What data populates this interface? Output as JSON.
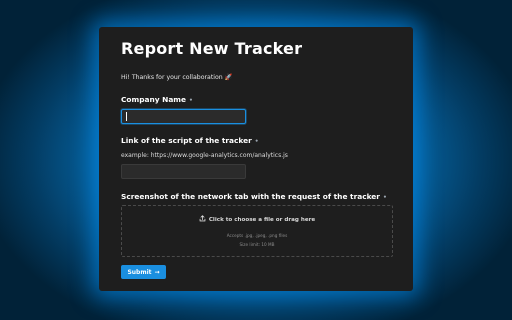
{
  "form": {
    "title": "Report New Tracker",
    "intro": "Hi! Thanks for your collaboration 🚀",
    "required_marker": "•",
    "company_label": "Company Name",
    "company_value": "",
    "link_label": "Link of the script of the tracker",
    "link_example": "example: https://www.google-analytics.com/analytics.js",
    "link_value": "",
    "screenshot_label": "Screenshot of the network tab with the request of the tracker",
    "dropzone": {
      "main_text": "Click to choose a file or drag here",
      "accepts": "Accepts .jpg, .jpeg, .png files",
      "size_limit": "Size limit: 10 MB"
    },
    "submit_label": "Submit",
    "submit_arrow": "→"
  },
  "colors": {
    "accent": "#1a8fe0",
    "card_bg": "#1e1e1e",
    "glow": "#0a86d6"
  },
  "icons": {
    "upload": "upload-icon",
    "arrow": "arrow-right-icon"
  }
}
